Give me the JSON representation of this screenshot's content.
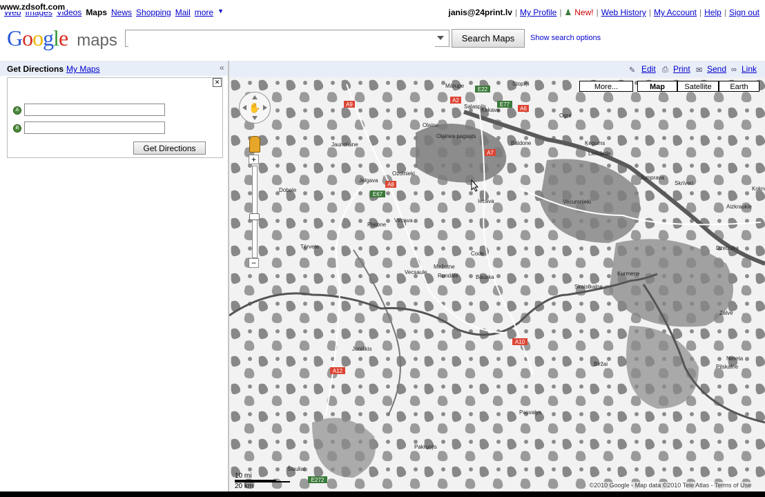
{
  "watermark": "www.zdsoft.com",
  "topnav": {
    "items": [
      "Web",
      "Images",
      "Videos",
      "Maps",
      "News",
      "Shopping",
      "Mail",
      "more"
    ],
    "current": "Maps"
  },
  "user": {
    "email": "janis@24print.lv",
    "my_profile": "My Profile",
    "new": "New!",
    "web_history": "Web History",
    "my_account": "My Account",
    "help": "Help",
    "sign_out": "Sign out",
    "sep": "|"
  },
  "logo": {
    "google": "Google",
    "maps": "maps"
  },
  "search": {
    "value": "",
    "placeholder": "",
    "button": "Search Maps",
    "options": "Show search options"
  },
  "panel": {
    "get_directions": "Get Directions",
    "my_maps": "My Maps",
    "collapse": "«",
    "close": "✕",
    "marker_a": "A",
    "marker_b": "B",
    "field_a": "",
    "field_b": "",
    "button": "Get Directions"
  },
  "maptools": {
    "edit": "Edit",
    "print": "Print",
    "send": "Send",
    "link": "Link"
  },
  "maptypes": {
    "more": "More...",
    "map": "Map",
    "satellite": "Satellite",
    "earth": "Earth",
    "active": "Map"
  },
  "scale": {
    "top": "10 mi",
    "bottom": "20 km"
  },
  "copyright": "©2010 Google - Map data ©2010 Tele Atlas - Terms of Use",
  "places": [
    {
      "name": "Salaspils"
    },
    {
      "name": "Ķekava"
    },
    {
      "name": "Baldone"
    },
    {
      "name": "Ogre"
    },
    {
      "name": "Ķegums"
    },
    {
      "name": "Lielvārde"
    },
    {
      "name": "Jelgava"
    },
    {
      "name": "Ozolnieki"
    },
    {
      "name": "Olaines pagasts"
    },
    {
      "name": "Iecava"
    },
    {
      "name": "Vecumnieki"
    },
    {
      "name": "Skrīveri"
    },
    {
      "name": "Aizkraukle"
    },
    {
      "name": "Dobele"
    },
    {
      "name": "Tērvete"
    },
    {
      "name": "Bauska"
    },
    {
      "name": "Joniškis"
    },
    {
      "name": "Pasvalys"
    },
    {
      "name": "Biržai"
    },
    {
      "name": "Pakruojis"
    },
    {
      "name": "Šiauliai"
    },
    {
      "name": "Jaunolaine"
    },
    {
      "name": "Jumprava"
    },
    {
      "name": "Koknese"
    },
    {
      "name": "Mārupe"
    },
    {
      "name": "Stopiņi"
    },
    {
      "name": "Olaine"
    },
    {
      "name": "Vircava"
    },
    {
      "name": "Platone"
    },
    {
      "name": "Mežotne"
    },
    {
      "name": "Vecsaule"
    },
    {
      "name": "Rundāle"
    },
    {
      "name": "Code"
    },
    {
      "name": "Skaistkalne"
    },
    {
      "name": "Kurmene"
    },
    {
      "name": "Nereta"
    },
    {
      "name": "Pilskalne"
    },
    {
      "name": "Zalve"
    },
    {
      "name": "Dzelzava"
    }
  ],
  "roads": [
    {
      "label": "A9",
      "color": "#d43"
    },
    {
      "label": "E22",
      "color": "#3a7a3a"
    },
    {
      "label": "E77",
      "color": "#3a7a3a"
    },
    {
      "label": "A6",
      "color": "#d43"
    },
    {
      "label": "A2",
      "color": "#d43"
    },
    {
      "label": "A7",
      "color": "#d43"
    },
    {
      "label": "A8",
      "color": "#d43"
    },
    {
      "label": "E67",
      "color": "#3a7a3a"
    },
    {
      "label": "A10",
      "color": "#d43"
    },
    {
      "label": "A12",
      "color": "#d43"
    },
    {
      "label": "E272",
      "color": "#3a7a3a"
    }
  ]
}
